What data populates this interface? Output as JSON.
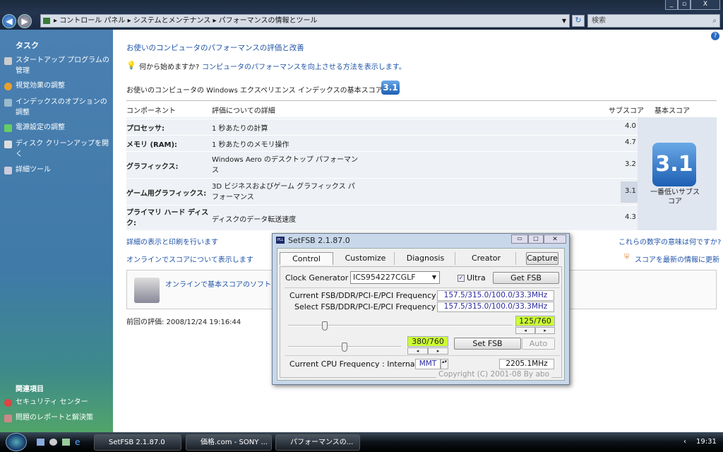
{
  "window": {
    "minimize": "_",
    "restore": "▫",
    "close": "X"
  },
  "address": {
    "breadcrumb": [
      "コントロール パネル",
      "システムとメンテナンス",
      "パフォーマンスの情報とツール"
    ],
    "search_placeholder": "検索"
  },
  "sidebar": {
    "tasks_title": "タスク",
    "tasks": [
      "スタートアップ プログラムの管理",
      "視覚効果の調整",
      "インデックスのオプションの調整",
      "電源設定の調整",
      "ディスク クリーンアップを開く",
      "詳細ツール"
    ],
    "related_title": "関連項目",
    "related": [
      "セキュリティ センター",
      "問題のレポートと解決策"
    ]
  },
  "main": {
    "heading": "お使いのコンピュータのパフォーマンスの評価と改善",
    "tip_prefix": "何から始めますか?",
    "tip_link": "コンピュータのパフォーマンスを向上させる方法を表示します。",
    "score_label": "お使いのコンピュータの Windows エクスペリエンス インデックスの基本スコア:",
    "base_score": "3.1",
    "table": {
      "headers": [
        "コンポーネント",
        "評価についての詳細",
        "サブスコア",
        "基本スコア"
      ],
      "rows": [
        {
          "component": "プロセッサ:",
          "detail": "1 秒あたりの計算",
          "score": "4.0"
        },
        {
          "component": "メモリ (RAM):",
          "detail": "1 秒あたりのメモリ操作",
          "score": "4.7"
        },
        {
          "component": "グラフィックス:",
          "detail": "Windows Aero のデスクトップ パフォーマンス",
          "score": "3.2"
        },
        {
          "component": "ゲーム用グラフィックス:",
          "detail": "3D ビジネスおよびゲーム グラフィックス パフォーマンス",
          "score": "3.1"
        },
        {
          "component": "プライマリ ハード ディスク:",
          "detail": "ディスクのデータ転送速度",
          "score": "4.3"
        }
      ],
      "base_caption": "一番低いサブスコア"
    },
    "link_print": "詳細の表示と印刷を行います",
    "link_meaning": "これらの数字の意味は何ですか?",
    "link_online": "オンラインでスコアについて表示します",
    "link_update": "スコアを最新の情報に更新",
    "online_software": "オンラインで基本スコアのソフトウ",
    "last_rating": "前回の評価: 2008/12/24 19:16:44"
  },
  "dialog": {
    "title": "SetFSB 2.1.87.0",
    "tabs": [
      "Control",
      "Customize",
      "Diagnosis",
      "Creator"
    ],
    "capture": "Capture",
    "clock_label": "Clock Generator",
    "clock_value": "ICS954227CGLF",
    "ultra": "Ultra",
    "ultra_checked": true,
    "get_fsb": "Get FSB",
    "current_label": "Current FSB/DDR/PCI-E/PCI Frequency",
    "current_value": "157.5/315.0/100.0/33.3MHz",
    "select_label": "Select FSB/DDR/PCI-E/PCI Frequency",
    "select_value": "157.5/315.0/100.0/33.3MHz",
    "slider1": "125/760",
    "slider1_value": 125,
    "slider2": "380/760",
    "slider2_value": 380,
    "slider_max": 760,
    "set_fsb": "Set FSB",
    "auto": "Auto",
    "cpu_label": "Current CPU Frequency : Internal",
    "cpu_mode": "MMT",
    "cpu_freq": "2205.1MHz",
    "copyright": "Copyright (C) 2001-08 By abo"
  },
  "taskbar": {
    "tasks": [
      "SetFSB 2.1.87.0",
      "価格.com - SONY ...",
      "パフォーマンスの..."
    ],
    "clock": "19:31"
  }
}
